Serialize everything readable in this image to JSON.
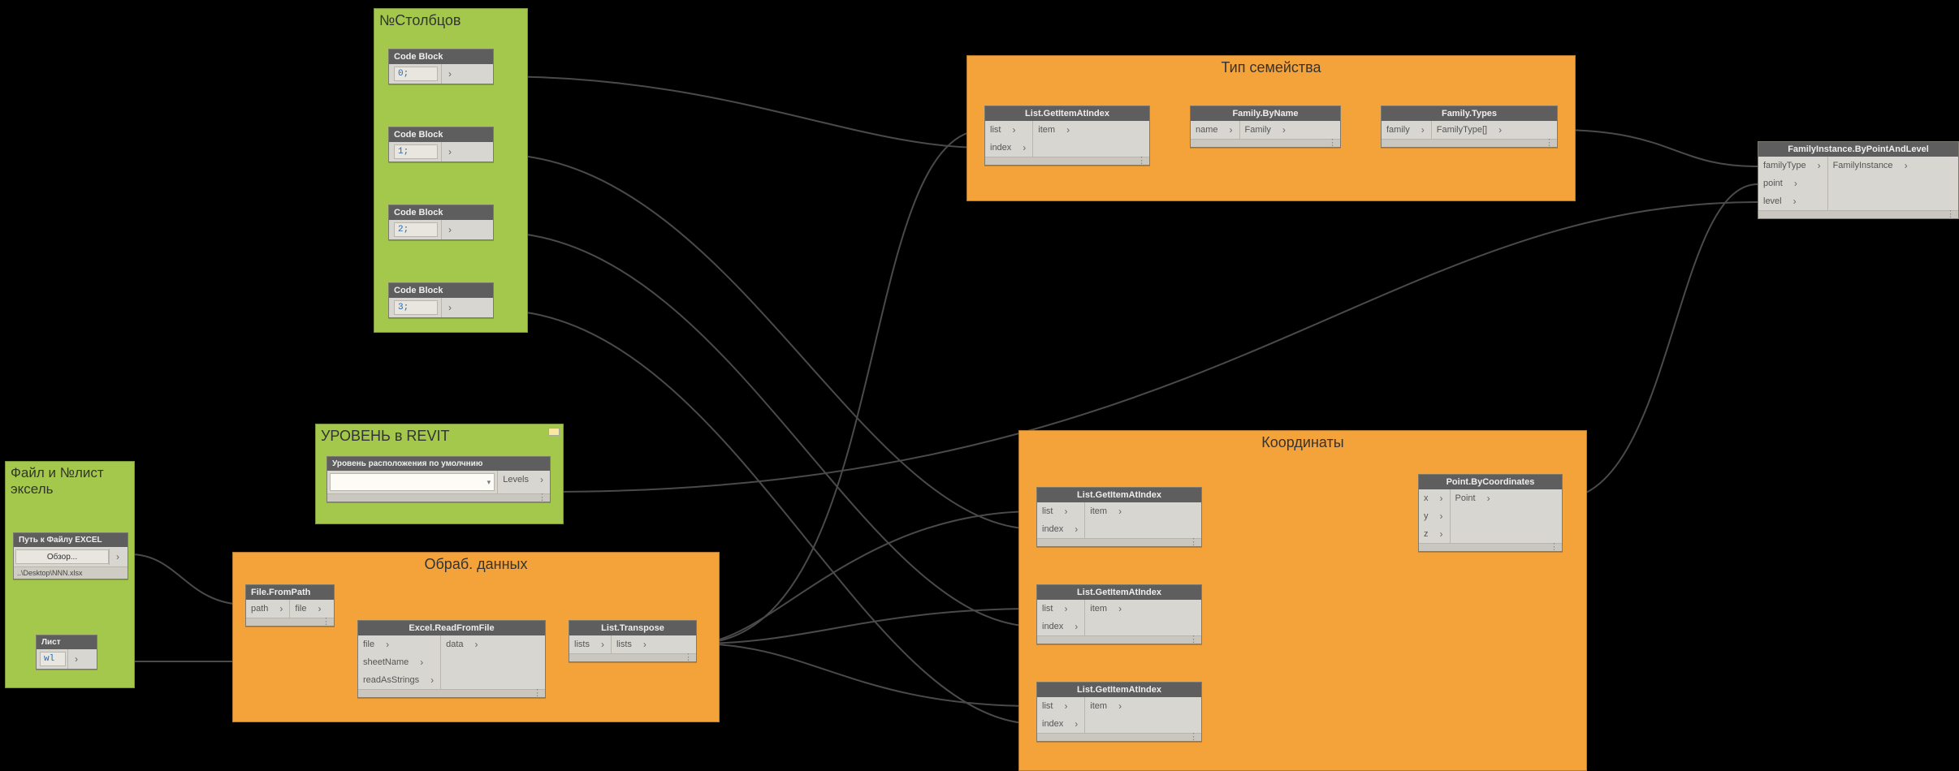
{
  "groups": {
    "cols": {
      "title": "№Столбцов"
    },
    "file": {
      "title": "Файл и №лист эксель"
    },
    "level": {
      "title": "УРОВЕНЬ в REVIT"
    },
    "proc": {
      "title": "Обраб. данных"
    },
    "ftype": {
      "title": "Тип семейства"
    },
    "coords": {
      "title": "Координаты"
    }
  },
  "codeBlocks": {
    "title": "Code Block",
    "v0": "0;",
    "v1": "1;",
    "v2": "2;",
    "v3": "3;"
  },
  "pathNode": {
    "title": "Путь к Файлу EXCEL",
    "button": "Обзор...",
    "path": "..\\Desktop\\NNN.xlsx"
  },
  "sheetNode": {
    "title": "Лист",
    "value": "wl"
  },
  "levelNode": {
    "title": "Уровень расположения по умолчнию",
    "selected": "",
    "outPort": "Levels"
  },
  "fileFromPath": {
    "title": "File.FromPath",
    "in0": "path",
    "out0": "file"
  },
  "excelRead": {
    "title": "Excel.ReadFromFile",
    "in0": "file",
    "in1": "sheetName",
    "in2": "readAsStrings",
    "out0": "data"
  },
  "transpose": {
    "title": "List.Transpose",
    "in0": "lists",
    "out0": "lists"
  },
  "getItem": {
    "title": "List.GetItemAtIndex",
    "in0": "list",
    "in1": "index",
    "out0": "item"
  },
  "famByName": {
    "title": "Family.ByName",
    "in0": "name",
    "out0": "Family"
  },
  "famTypes": {
    "title": "Family.Types",
    "in0": "family",
    "out0": "FamilyType[]"
  },
  "pointByC": {
    "title": "Point.ByCoordinates",
    "in0": "x",
    "in1": "y",
    "in2": "z",
    "out0": "Point"
  },
  "famInst": {
    "title": "FamilyInstance.ByPointAndLevel",
    "in0": "familyType",
    "in1": "point",
    "in2": "level",
    "out0": "FamilyInstance"
  }
}
